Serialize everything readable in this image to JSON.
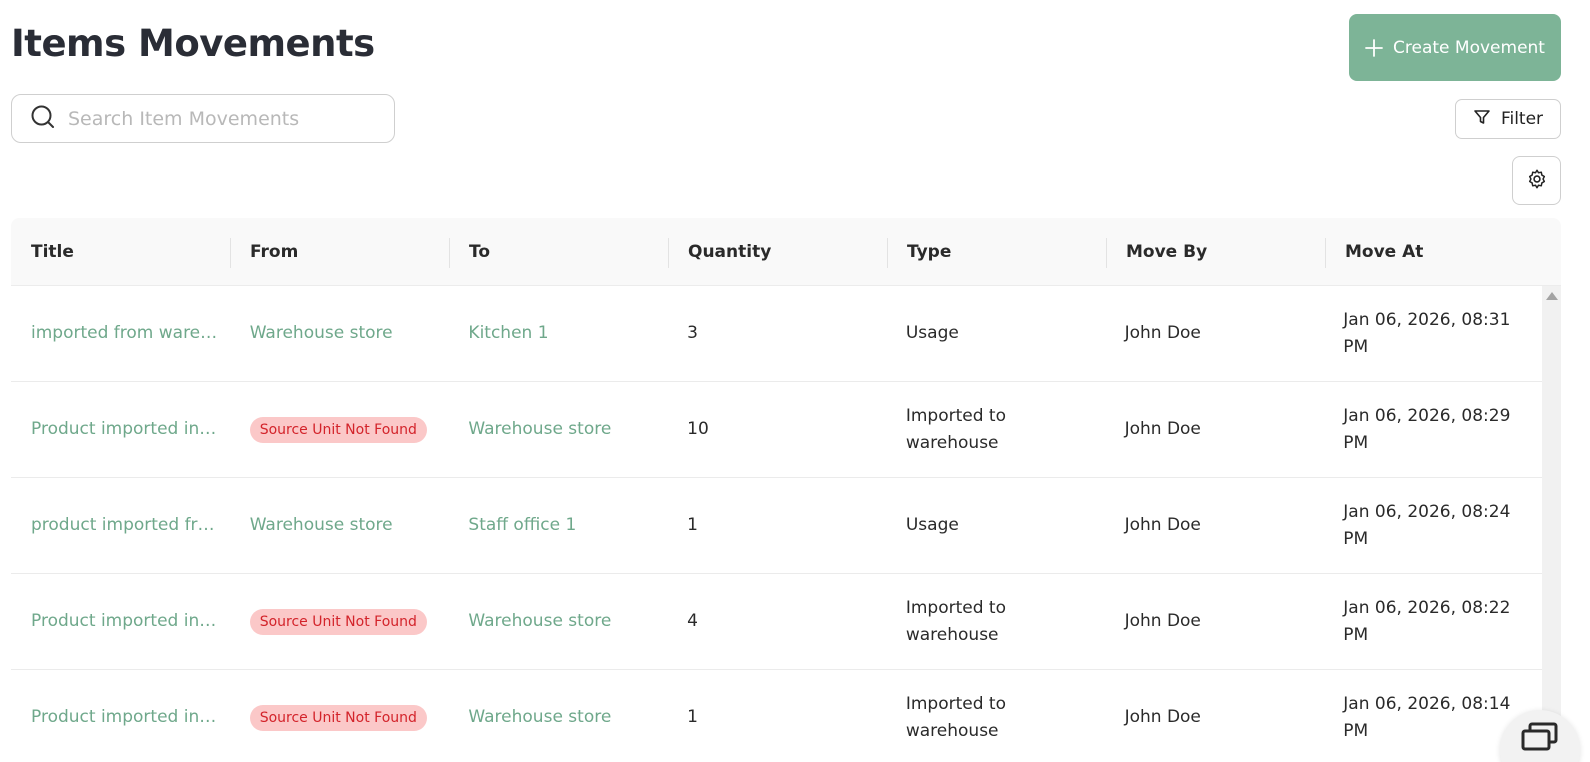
{
  "page": {
    "title": "Items Movements"
  },
  "toolbar": {
    "create_label": "Create Movement",
    "filter_label": "Filter",
    "search_placeholder": "Search Item Movements"
  },
  "colors": {
    "accent": "#7db497",
    "link": "#6fa88b",
    "badge_bg": "#fbc8c8",
    "badge_text": "#d3232a"
  },
  "icons": {
    "create": "plus-icon",
    "search": "search-icon",
    "filter": "funnel-icon",
    "settings": "gear-icon",
    "chat": "chat-icon"
  },
  "table": {
    "columns": [
      "Title",
      "From",
      "To",
      "Quantity",
      "Type",
      "Move By",
      "Move At"
    ],
    "rows": [
      {
        "title": "imported from ware…",
        "from": "Warehouse store",
        "from_badge": "",
        "to": "Kitchen 1",
        "quantity": "3",
        "type": "Usage",
        "move_by": "John Doe",
        "move_at": "Jan 06, 2026, 08:31 PM"
      },
      {
        "title": "Product imported in…",
        "from": "",
        "from_badge": "Source Unit Not Found",
        "to": "Warehouse store",
        "quantity": "10",
        "type": "Imported to warehouse",
        "move_by": "John Doe",
        "move_at": "Jan 06, 2026, 08:29 PM"
      },
      {
        "title": "product imported fr…",
        "from": "Warehouse store",
        "from_badge": "",
        "to": "Staff office 1",
        "quantity": "1",
        "type": "Usage",
        "move_by": "John Doe",
        "move_at": "Jan 06, 2026, 08:24 PM"
      },
      {
        "title": "Product imported in…",
        "from": "",
        "from_badge": "Source Unit Not Found",
        "to": "Warehouse store",
        "quantity": "4",
        "type": "Imported to warehouse",
        "move_by": "John Doe",
        "move_at": "Jan 06, 2026, 08:22 PM"
      },
      {
        "title": "Product imported in…",
        "from": "",
        "from_badge": "Source Unit Not Found",
        "to": "Warehouse store",
        "quantity": "1",
        "type": "Imported to warehouse",
        "move_by": "John Doe",
        "move_at": "Jan 06, 2026, 08:14 PM"
      }
    ]
  }
}
